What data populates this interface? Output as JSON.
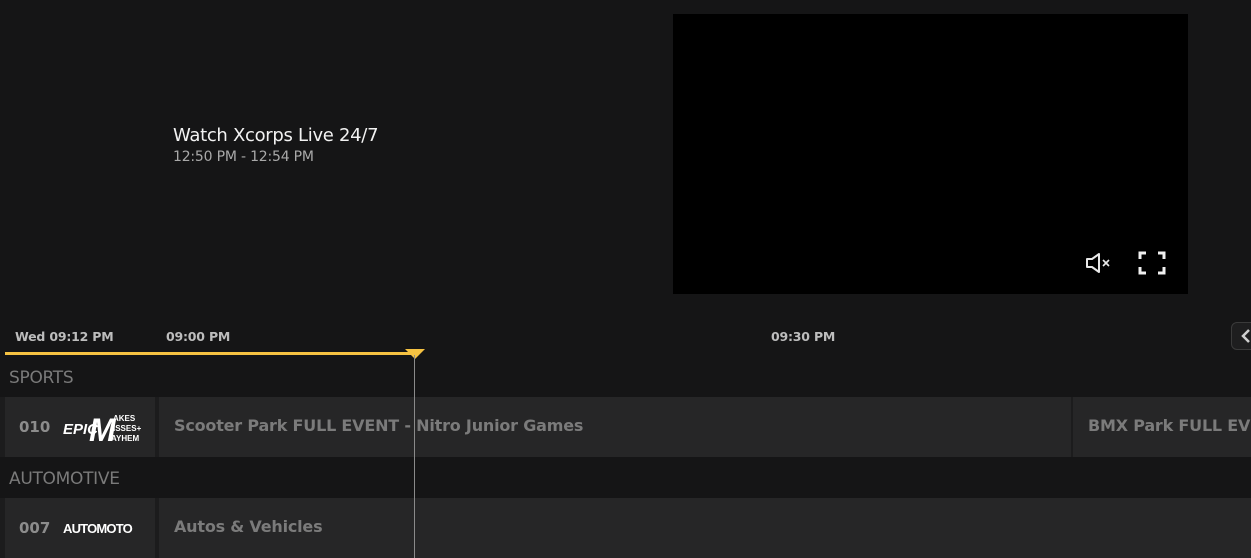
{
  "hero": {
    "title": "Watch Xcorps Live 24/7",
    "time": "12:50 PM - 12:54 PM"
  },
  "player": {
    "mute_icon": "speaker-muted-icon",
    "fullscreen_icon": "fullscreen-icon"
  },
  "timebar": {
    "now": "Wed 09:12 PM",
    "ticks": [
      "09:00 PM",
      "09:30 PM"
    ],
    "scroll_icon": "chevron-left-icon",
    "accent": "#f5c242"
  },
  "categories": [
    {
      "label": "SPORTS",
      "channels": [
        {
          "number": "010",
          "logo_text": {
            "big1": "EPIC",
            "big2": "M",
            "small1": "AKES",
            "small2": "ISSES+",
            "small3": "AYHEM"
          },
          "programs": [
            "Scooter Park FULL EVENT - Nitro Junior Games",
            "BMX Park FULL EVENT"
          ]
        }
      ]
    },
    {
      "label": "AUTOMOTIVE",
      "channels": [
        {
          "number": "007",
          "logo_text": {
            "big1": "AUTOMOTO"
          },
          "programs": [
            "Autos & Vehicles"
          ]
        }
      ]
    }
  ]
}
